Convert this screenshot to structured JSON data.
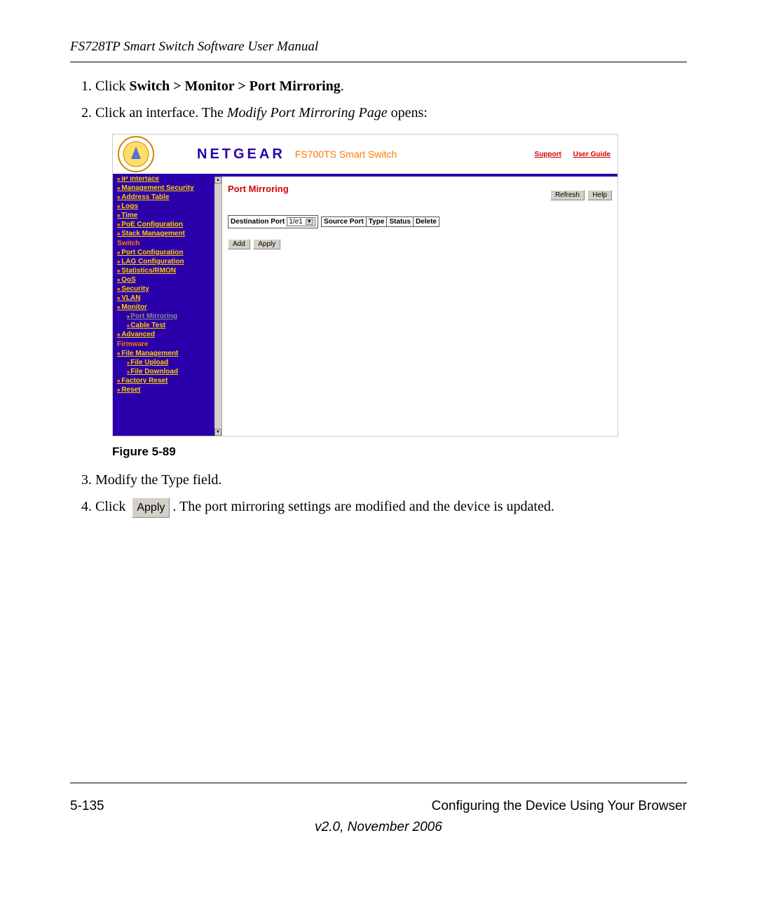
{
  "header": {
    "title": "FS728TP Smart Switch Software User Manual"
  },
  "steps": {
    "s1_a": "Click ",
    "s1_b": "Switch > Monitor > Port Mirroring",
    "s1_c": ".",
    "s2_a": "Click an interface. The ",
    "s2_b": "Modify Port Mirroring Page",
    "s2_c": " opens:",
    "s3": "Modify the Type field.",
    "s4_a": "Click ",
    "s4_btn": "Apply",
    "s4_b": ". The port mirroring settings are modified and the device is updated."
  },
  "figure": {
    "caption": "Figure 5-89"
  },
  "shot": {
    "brand": "NETGEAR",
    "subbrand": "FS700TS Smart Switch",
    "toplinks": {
      "support": "Support",
      "guide": "User Guide"
    },
    "nav": {
      "cut": "IP Interface",
      "mgmt_sec": "Management Security",
      "addr": "Address Table",
      "logs": "Logs",
      "time": "Time",
      "poe": "PoE Configuration",
      "stack": "Stack Management",
      "cat_switch": "Switch",
      "port_cfg": "Port Configuration",
      "lag": "LAG Configuration",
      "stats": "Statistics/RMON",
      "qos": "QoS",
      "security": "Security",
      "vlan": "VLAN",
      "monitor": "Monitor",
      "port_mirror": "Port Mirroring",
      "cable": "Cable Test",
      "advanced": "Advanced",
      "cat_fw": "Firmware",
      "file_mgmt": "File Management",
      "file_up": "File Upload",
      "file_down": "File Download",
      "factory": "Factory Reset",
      "reset": "Reset"
    },
    "content": {
      "title": "Port Mirroring",
      "refresh": "Refresh",
      "help": "Help",
      "dest_label": "Destination Port",
      "dest_value": "1/e1",
      "th1": "Source Port",
      "th2": "Type",
      "th3": "Status",
      "th4": "Delete",
      "add": "Add",
      "apply": "Apply"
    }
  },
  "footer": {
    "page": "5-135",
    "section": "Configuring the Device Using Your Browser",
    "version": "v2.0, November 2006"
  }
}
